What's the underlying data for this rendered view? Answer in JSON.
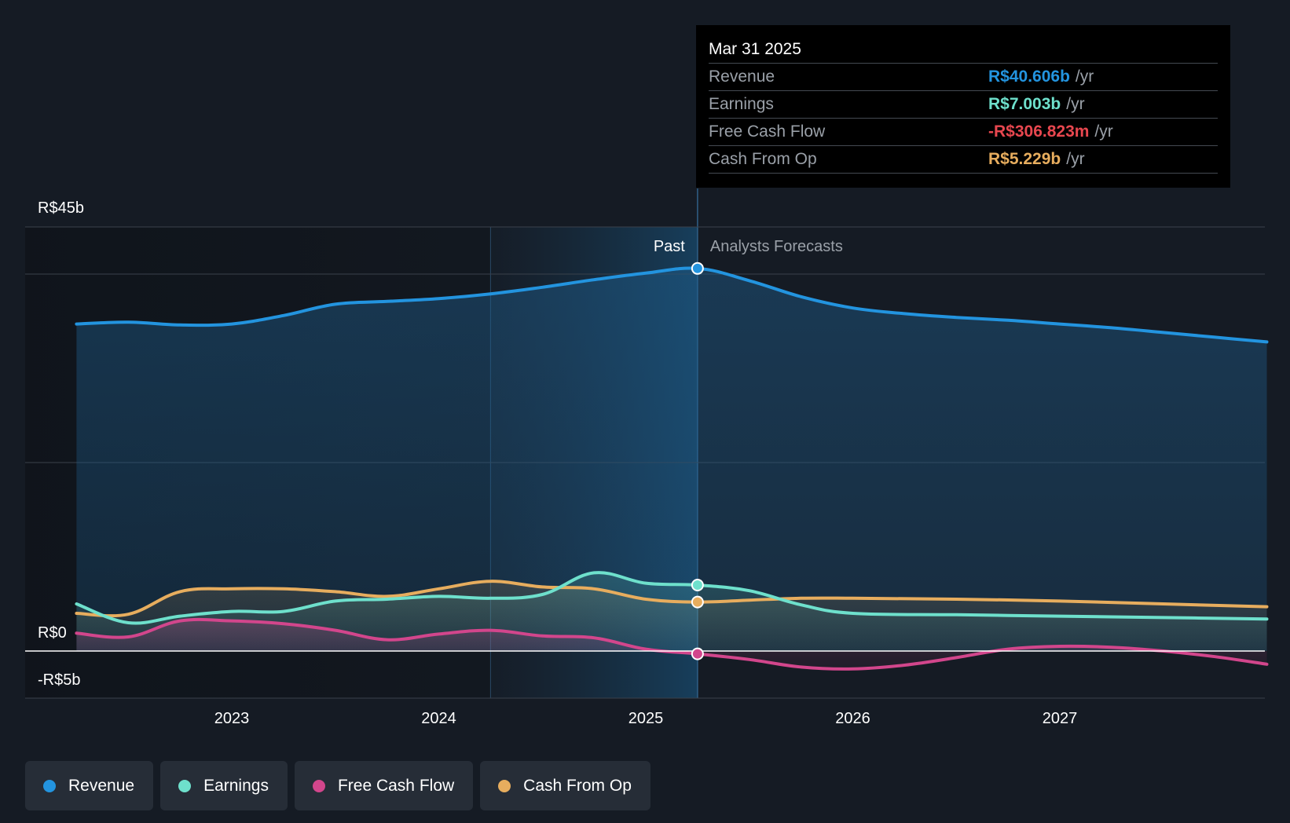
{
  "colors": {
    "background": "#151b24",
    "revenue": "#2394df",
    "earnings": "#6ee0cc",
    "free_cash_flow": "#d2468c",
    "cash_from_op": "#e7ad5e",
    "negative": "#e8474f",
    "tooltip_muted": "#9aa0a8"
  },
  "chart_data": {
    "type": "line",
    "title": "",
    "xlabel": "",
    "ylabel": "",
    "x_ticks": [
      2023,
      2024,
      2025,
      2026,
      2027
    ],
    "xlim": [
      2022.25,
      2028.0
    ],
    "ylim": [
      -5,
      45
    ],
    "y_labels": [
      {
        "value": 45,
        "label": "R$45b"
      },
      {
        "value": 0,
        "label": "R$0"
      },
      {
        "value": -5,
        "label": "-R$5b"
      }
    ],
    "grid_values": [
      45,
      40,
      20,
      0,
      -5
    ],
    "past_label": "Past",
    "forecast_label": "Analysts Forecasts",
    "past_end": 2025.25,
    "highlight_start": 2024.25,
    "series": [
      {
        "name": "Revenue",
        "key": "revenue",
        "points": [
          [
            2022.25,
            34.7
          ],
          [
            2022.5,
            34.9
          ],
          [
            2022.75,
            34.6
          ],
          [
            2023.0,
            34.7
          ],
          [
            2023.25,
            35.6
          ],
          [
            2023.5,
            36.8
          ],
          [
            2023.75,
            37.1
          ],
          [
            2024.0,
            37.4
          ],
          [
            2024.25,
            37.9
          ],
          [
            2024.5,
            38.6
          ],
          [
            2024.75,
            39.4
          ],
          [
            2025.0,
            40.1
          ],
          [
            2025.25,
            40.6
          ],
          [
            2025.5,
            39.3
          ],
          [
            2025.75,
            37.6
          ],
          [
            2026.0,
            36.4
          ],
          [
            2026.25,
            35.8
          ],
          [
            2026.5,
            35.4
          ],
          [
            2026.75,
            35.1
          ],
          [
            2027.0,
            34.7
          ],
          [
            2027.25,
            34.3
          ],
          [
            2027.5,
            33.8
          ],
          [
            2027.75,
            33.3
          ],
          [
            2028.0,
            32.8
          ]
        ]
      },
      {
        "name": "Earnings",
        "key": "earnings",
        "points": [
          [
            2022.25,
            5.0
          ],
          [
            2022.5,
            3.0
          ],
          [
            2022.75,
            3.7
          ],
          [
            2023.0,
            4.2
          ],
          [
            2023.25,
            4.2
          ],
          [
            2023.5,
            5.3
          ],
          [
            2023.75,
            5.5
          ],
          [
            2024.0,
            5.8
          ],
          [
            2024.25,
            5.6
          ],
          [
            2024.5,
            6.0
          ],
          [
            2024.75,
            8.3
          ],
          [
            2025.0,
            7.2
          ],
          [
            2025.25,
            7.0
          ],
          [
            2025.5,
            6.4
          ],
          [
            2025.75,
            4.9
          ],
          [
            2026.0,
            4.0
          ],
          [
            2026.5,
            3.85
          ],
          [
            2027.0,
            3.7
          ],
          [
            2027.5,
            3.55
          ],
          [
            2028.0,
            3.4
          ]
        ]
      },
      {
        "name": "Free Cash Flow",
        "key": "free_cash_flow",
        "points": [
          [
            2022.25,
            1.9
          ],
          [
            2022.5,
            1.5
          ],
          [
            2022.75,
            3.2
          ],
          [
            2023.0,
            3.2
          ],
          [
            2023.25,
            2.9
          ],
          [
            2023.5,
            2.2
          ],
          [
            2023.75,
            1.2
          ],
          [
            2024.0,
            1.8
          ],
          [
            2024.25,
            2.2
          ],
          [
            2024.5,
            1.6
          ],
          [
            2024.75,
            1.4
          ],
          [
            2025.0,
            0.2
          ],
          [
            2025.25,
            -0.3
          ],
          [
            2025.5,
            -0.9
          ],
          [
            2025.75,
            -1.7
          ],
          [
            2026.0,
            -1.9
          ],
          [
            2026.25,
            -1.5
          ],
          [
            2026.5,
            -0.7
          ],
          [
            2026.75,
            0.2
          ],
          [
            2027.0,
            0.5
          ],
          [
            2027.25,
            0.4
          ],
          [
            2027.5,
            0.0
          ],
          [
            2027.75,
            -0.6
          ],
          [
            2028.0,
            -1.4
          ]
        ]
      },
      {
        "name": "Cash From Op",
        "key": "cash_from_op",
        "points": [
          [
            2022.25,
            4.0
          ],
          [
            2022.5,
            3.9
          ],
          [
            2022.75,
            6.3
          ],
          [
            2023.0,
            6.6
          ],
          [
            2023.25,
            6.6
          ],
          [
            2023.5,
            6.3
          ],
          [
            2023.75,
            5.8
          ],
          [
            2024.0,
            6.6
          ],
          [
            2024.25,
            7.4
          ],
          [
            2024.5,
            6.8
          ],
          [
            2024.75,
            6.6
          ],
          [
            2025.0,
            5.5
          ],
          [
            2025.25,
            5.2
          ],
          [
            2025.5,
            5.4
          ],
          [
            2025.75,
            5.6
          ],
          [
            2026.0,
            5.6
          ],
          [
            2026.5,
            5.5
          ],
          [
            2027.0,
            5.3
          ],
          [
            2027.5,
            5.0
          ],
          [
            2028.0,
            4.7
          ]
        ]
      }
    ],
    "highlight_points": [
      {
        "key": "revenue",
        "x": 2025.25,
        "y": 40.6
      },
      {
        "key": "earnings",
        "x": 2025.25,
        "y": 7.0
      },
      {
        "key": "cash_from_op",
        "x": 2025.25,
        "y": 5.2
      },
      {
        "key": "free_cash_flow",
        "x": 2025.25,
        "y": -0.3
      }
    ],
    "legend_position": "bottom-left"
  },
  "tooltip": {
    "date": "Mar 31 2025",
    "rows": [
      {
        "label": "Revenue",
        "value": "R$40.606b",
        "unit": "/yr"
      },
      {
        "label": "Earnings",
        "value": "R$7.003b",
        "unit": "/yr"
      },
      {
        "label": "Free Cash Flow",
        "value": "-R$306.823m",
        "unit": "/yr"
      },
      {
        "label": "Cash From Op",
        "value": "R$5.229b",
        "unit": "/yr"
      }
    ]
  },
  "legend": {
    "items": [
      {
        "label": "Revenue"
      },
      {
        "label": "Earnings"
      },
      {
        "label": "Free Cash Flow"
      },
      {
        "label": "Cash From Op"
      }
    ]
  }
}
